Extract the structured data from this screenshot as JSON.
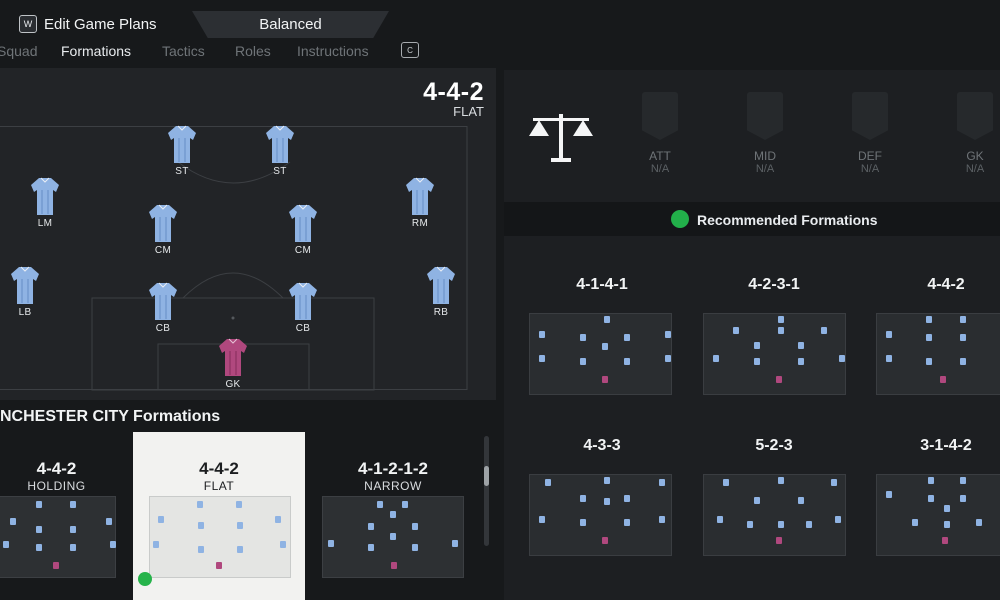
{
  "header": {
    "key_w": "W",
    "title": "Edit Game Plans",
    "plan": "Balanced",
    "key_c": "C"
  },
  "tabs": [
    "Squad",
    "Formations",
    "Tactics",
    "Roles",
    "Instructions"
  ],
  "current": {
    "name": "4-4-2",
    "sub": "FLAT"
  },
  "positions": [
    "ST",
    "ST",
    "LM",
    "CM",
    "CM",
    "RM",
    "LB",
    "CB",
    "CB",
    "RB",
    "GK"
  ],
  "team_formations": {
    "title": "NCHESTER CITY Formations",
    "items": [
      {
        "name": "4-4-2",
        "sub": "HOLDING"
      },
      {
        "name": "4-4-2",
        "sub": "FLAT"
      },
      {
        "name": "4-1-2-1-2",
        "sub": "NARROW"
      }
    ]
  },
  "stats": [
    {
      "key": "ATT",
      "value": "N/A"
    },
    {
      "key": "MID",
      "value": "N/A"
    },
    {
      "key": "DEF",
      "value": "N/A"
    },
    {
      "key": "GK",
      "value": "N/A"
    }
  ],
  "recommended": {
    "label": "Recommended Formations",
    "items": [
      "4-1-4-1",
      "4-2-3-1",
      "4-4-2",
      "4-3-3",
      "5-2-3",
      "3-1-4-2"
    ]
  },
  "colors": {
    "shirt": "#8fb3e3",
    "gk_shirt": "#b0487e",
    "check": "#22b04a"
  },
  "icons": [
    "key-w-icon",
    "key-c-icon",
    "scales-icon",
    "check-badge-icon",
    "recommended-icon"
  ]
}
